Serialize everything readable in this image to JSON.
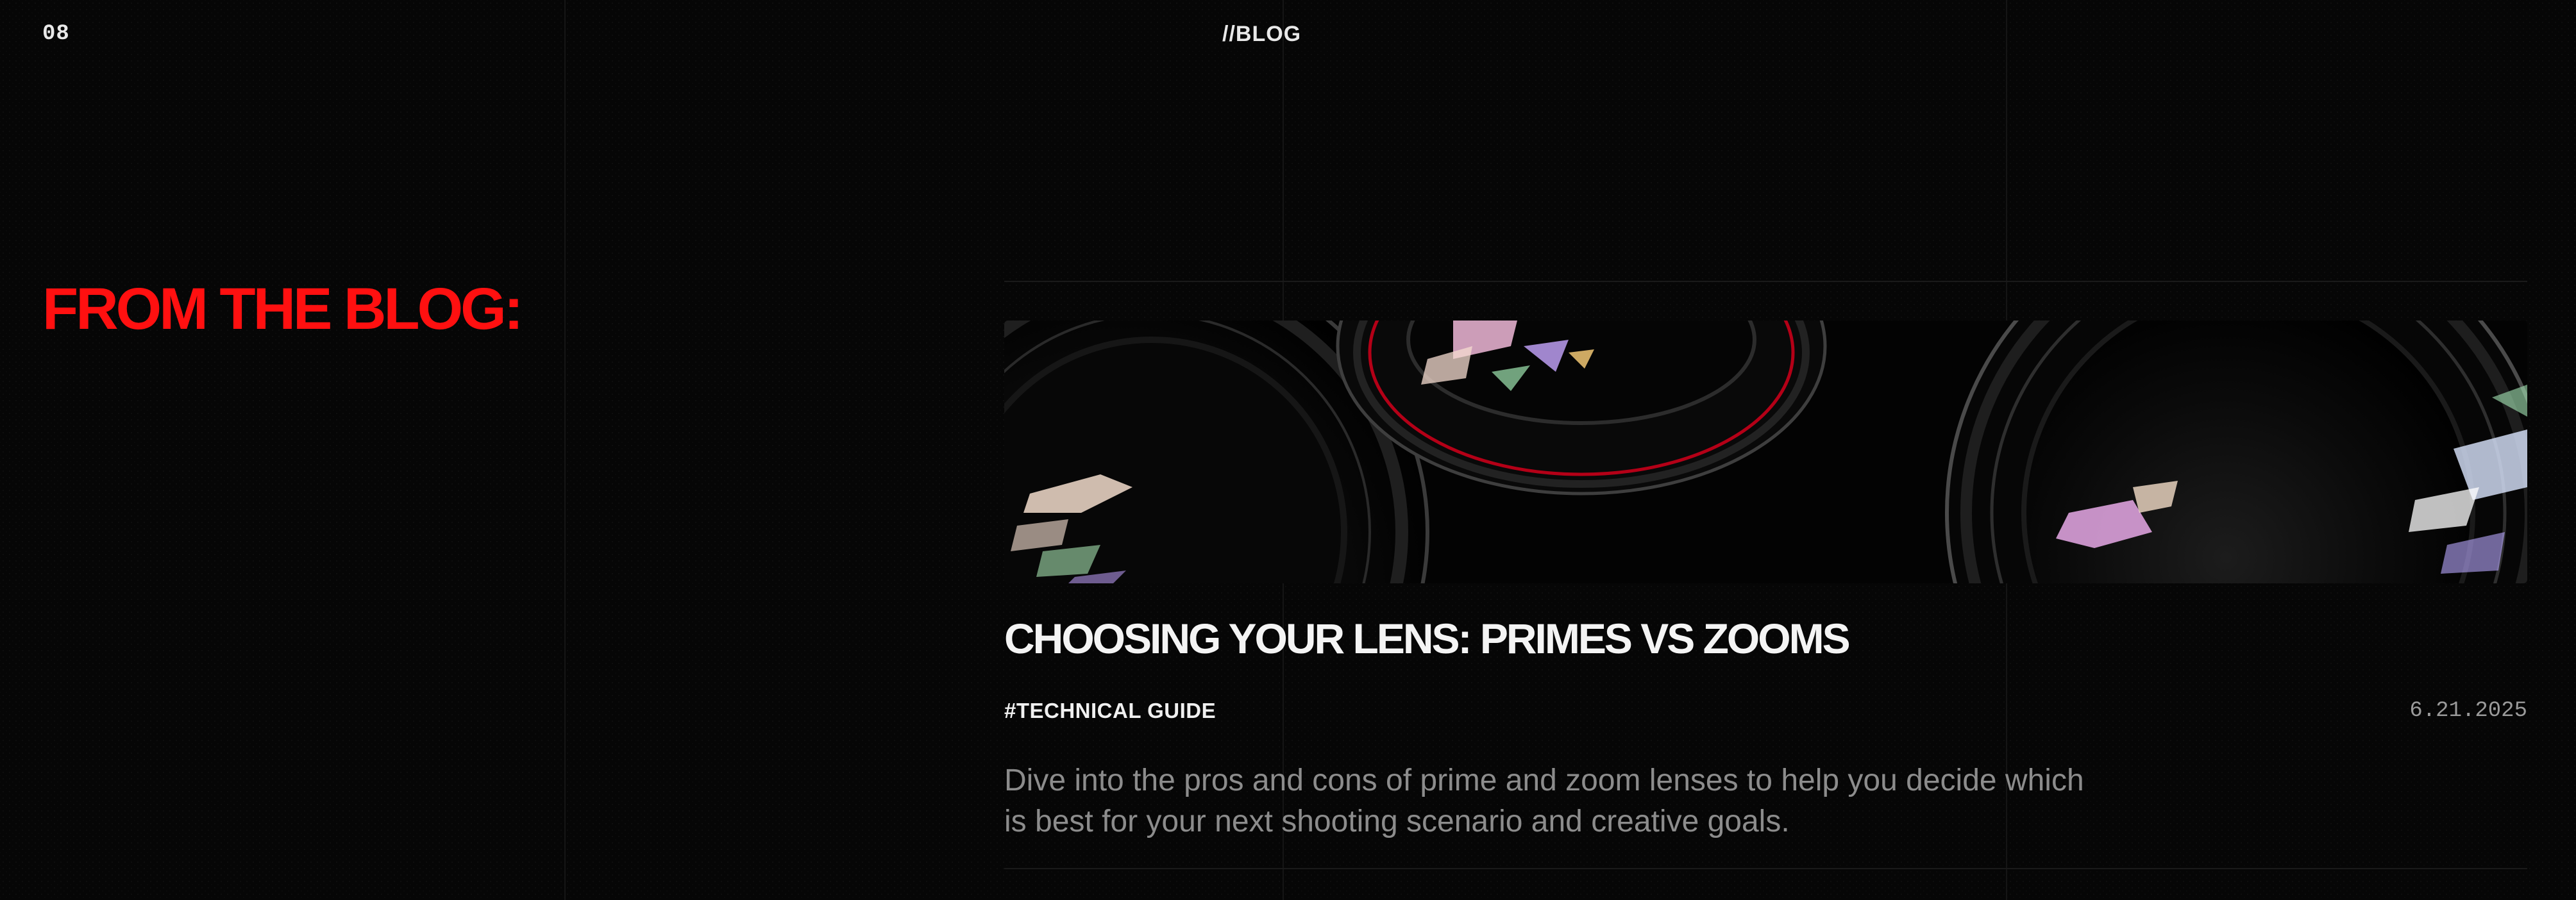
{
  "section": {
    "number": "08",
    "tag": "//BLOG"
  },
  "heading": "FROM THE BLOG:",
  "post": {
    "image_alt": "camera-lenses-photo",
    "title": "CHOOSING YOUR LENS: PRIMES VS ZOOMS",
    "tag": "#TECHNICAL GUIDE",
    "date": "6.21.2025",
    "excerpt": "Dive into the pros and cons of prime and zoom lenses to help you decide which is best for your next shooting scenario and creative goals."
  },
  "colors": {
    "background": "#060606",
    "accent": "#ff1010",
    "title": "#f4f4f4",
    "muted": "#8c8c8c",
    "grid_line": "#151515"
  }
}
